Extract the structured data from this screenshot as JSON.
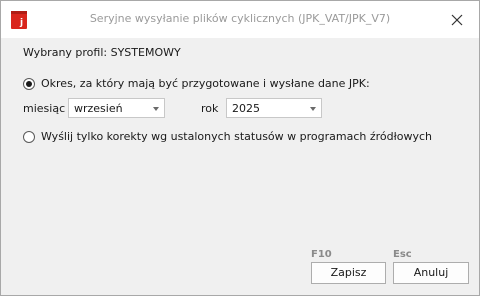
{
  "window": {
    "title": "Seryjne wysyłanie plików cyklicznych (JPK_VAT/JPK_V7)",
    "icon": "jpk-app-icon",
    "close_icon": "close-icon"
  },
  "profile": {
    "label": "Wybrany profil: SYSTEMOWY"
  },
  "options": {
    "period": {
      "label": "Okres, za który mają być przygotowane i wysłane dane JPK:",
      "selected": true
    },
    "corrections": {
      "label": "Wyślij tylko korekty wg ustalonych statusów w programach źródłowych",
      "selected": false
    }
  },
  "period": {
    "month_label": "miesiąc",
    "month_value": "wrzesień",
    "year_label": "rok",
    "year_value": "2025"
  },
  "actions": {
    "save_hotkey": "F10",
    "save_label": "Zapisz",
    "cancel_hotkey": "Esc",
    "cancel_label": "Anuluj"
  },
  "colors": {
    "accent": "#d9251c",
    "background": "#f0f0f0",
    "title_text": "#9a9a9a"
  }
}
